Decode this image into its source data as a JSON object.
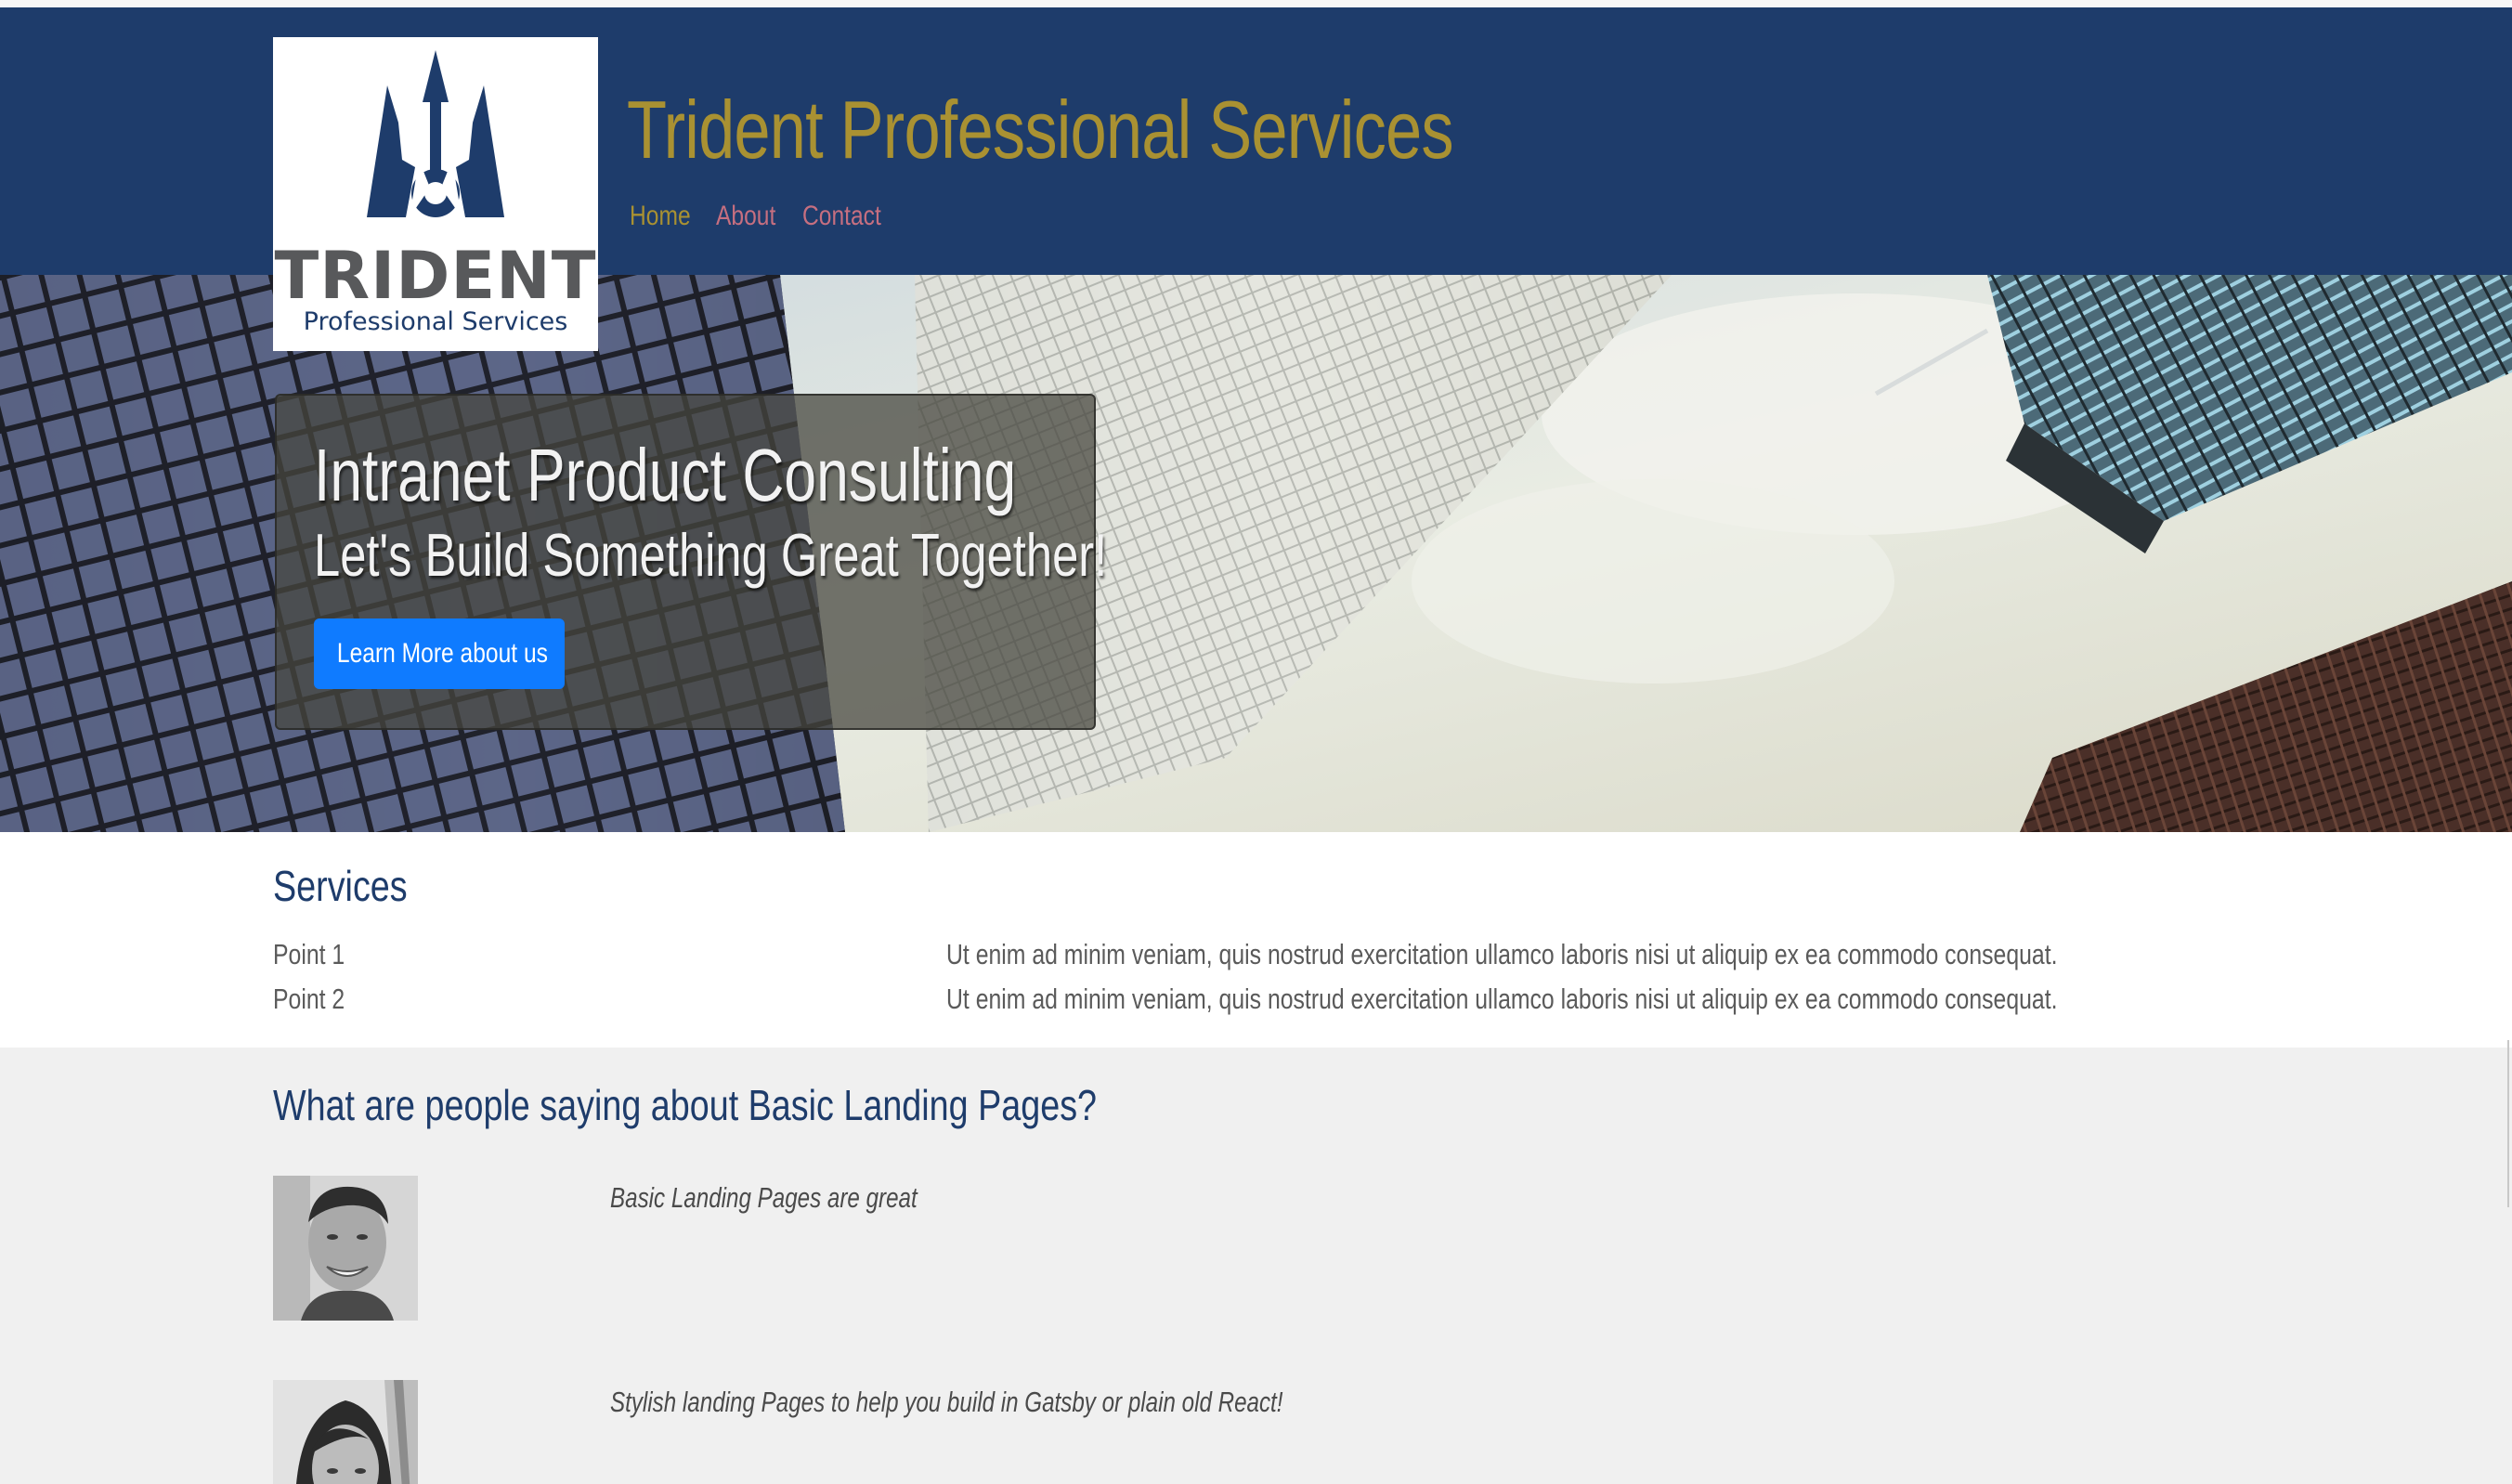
{
  "header": {
    "site_title": "Trident Professional Services",
    "logo": {
      "word": "TRIDENT",
      "tagline": "Professional Services"
    },
    "nav": [
      {
        "label": "Home"
      },
      {
        "label": "About"
      },
      {
        "label": "Contact"
      }
    ]
  },
  "hero": {
    "heading": "Intranet Product Consulting",
    "subheading": "Let's Build Something Great Together!",
    "button_label": "Learn More about us"
  },
  "services": {
    "title": "Services",
    "items": [
      {
        "label": "Point 1",
        "text": "Ut enim ad minim veniam, quis nostrud exercitation ullamco laboris nisi ut aliquip ex ea commodo consequat."
      },
      {
        "label": "Point 2",
        "text": "Ut enim ad minim veniam, quis nostrud exercitation ullamco laboris nisi ut aliquip ex ea commodo consequat."
      }
    ]
  },
  "testimonials": {
    "title": "What are people saying about Basic Landing Pages?",
    "items": [
      {
        "quote": "Basic Landing Pages are great",
        "avatar": "man-portrait"
      },
      {
        "quote": "Stylish landing Pages to help you build in Gatsby or plain old React!",
        "avatar": "woman-portrait"
      }
    ]
  },
  "colors": {
    "header_bg": "#1e3c6b",
    "title_gold": "#a99132",
    "nav_link": "#c66f80",
    "button_blue": "#0f7bff",
    "testimonials_bg": "#f0f0f0"
  }
}
